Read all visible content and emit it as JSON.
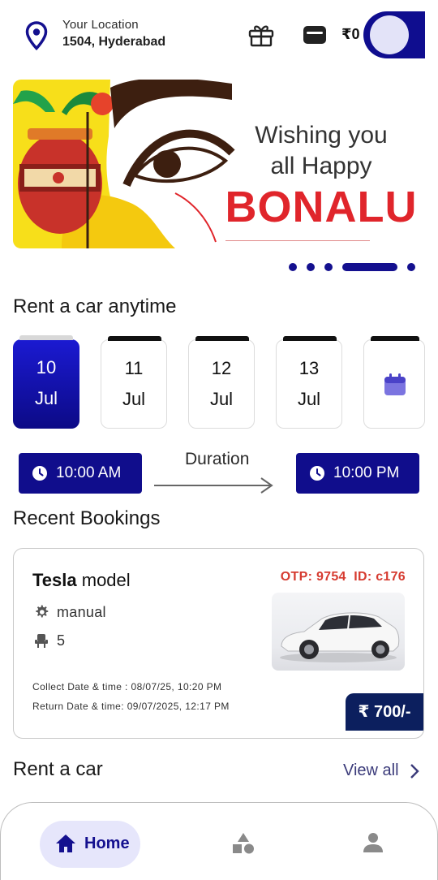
{
  "header": {
    "location_caption": "Your Location",
    "location_value": "1504, Hyderabad",
    "balance": "₹0",
    "icons": [
      "location-pin-icon",
      "gift-icon",
      "wallet-icon",
      "profile-avatar"
    ]
  },
  "banner": {
    "line1": "Wishing you",
    "line2": "all Happy",
    "headline": "BONALU",
    "carousel_pages": 5,
    "carousel_active_index": 3
  },
  "rent_anytime": {
    "title": "Rent a car anytime",
    "dates": [
      {
        "day": "10",
        "month": "Jul",
        "selected": true
      },
      {
        "day": "11",
        "month": "Jul",
        "selected": false
      },
      {
        "day": "12",
        "month": "Jul",
        "selected": false
      },
      {
        "day": "13",
        "month": "Jul",
        "selected": false
      }
    ],
    "calendar_icon": "calendar-icon",
    "start_time": "10:00 AM",
    "duration_label": "Duration",
    "end_time": "10:00 PM"
  },
  "recent_bookings": {
    "title": "Recent Bookings",
    "booking": {
      "brand": "Tesla",
      "model": "model",
      "otp_id": "OTP: 9754  ID: c176",
      "transmission": "manual",
      "seats": "5",
      "collect": "Collect Date & time : 08/07/25, 10:20 PM",
      "return": "Return Date & time: 09/07/2025, 12:17 PM",
      "price": "₹ 700/-"
    }
  },
  "rent_a_car": {
    "title": "Rent a car",
    "view_all": "View all"
  },
  "bottom_nav": {
    "home": "Home",
    "icons": [
      "home-icon",
      "shapes-icon",
      "user-icon"
    ]
  },
  "colors": {
    "primary": "#100d8c",
    "accent_red": "#e0252b",
    "otp_red": "#d63b30",
    "price_bg": "#0c1f5e",
    "nav_pill": "#e6e6fb"
  }
}
